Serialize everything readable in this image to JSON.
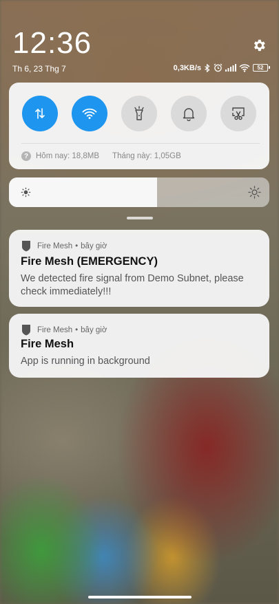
{
  "status_bar": {
    "time": "12:36",
    "date": "Th 6, 23 Thg 7",
    "network_speed": "0,3KB/s",
    "battery_level": "52",
    "icons": [
      "bluetooth-icon",
      "alarm-icon",
      "signal-icon",
      "wifi-icon",
      "battery-icon"
    ]
  },
  "quick_settings": {
    "tiles": [
      {
        "name": "mobile-data",
        "icon": "data-transfer-icon",
        "active": true
      },
      {
        "name": "wifi",
        "icon": "wifi-icon",
        "active": true
      },
      {
        "name": "flashlight",
        "icon": "flashlight-icon",
        "active": false
      },
      {
        "name": "sound",
        "icon": "bell-icon",
        "active": false
      },
      {
        "name": "screenshot",
        "icon": "scissors-screen-icon",
        "active": false
      }
    ],
    "usage_today": "Hôm nay: 18,8MB",
    "usage_month": "Tháng này: 1,05GB",
    "accent_color": "#1e95ee"
  },
  "brightness": {
    "level": 0.57
  },
  "notifications": [
    {
      "app": "Fire Mesh",
      "time": "bây giờ",
      "title": "Fire Mesh (EMERGENCY)",
      "body": "We detected fire signal from Demo Subnet, please check immediately!!!"
    },
    {
      "app": "Fire Mesh",
      "time": "bây giờ",
      "title": "Fire Mesh",
      "body": "App is running in background"
    }
  ]
}
